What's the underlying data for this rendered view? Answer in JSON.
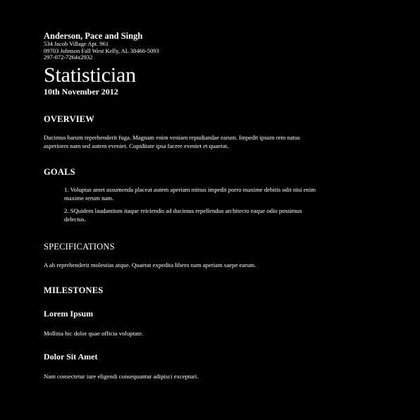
{
  "header": {
    "company": "Anderson, Pace and Singh",
    "address_line1": "534 Jacob Village Apt. 961",
    "address_line2": "09703 Johnson Fall West Kelly, AL 38466-5093",
    "phone": "297-072-7264x2932"
  },
  "document": {
    "title": "Statistician",
    "date": "10th November 2012"
  },
  "overview": {
    "heading": "OVERVIEW",
    "text": "Ducimus harum reprehenderit fuga. Magnam enim veniam repudiandae earum. Impedit ipsum rem natus asperiores nam sed autem eveniet. Cupiditate ipsa facere eveniet et quaerat."
  },
  "goals": {
    "heading": "GOALS",
    "items": [
      "1. Voluptas amet assumenda placeat autem aperiam minus impedit porro maxime debitis odit nisi enim maxime rerum nam.",
      "2. SQuidem laudantium itaque reiciendis ad ducimus repellendus architecto eaque odio possimus delectus."
    ]
  },
  "specifications": {
    "heading": "SPECIFICATIONS",
    "text": "A ab reprehenderit molestias atque. Quaerat expedita libero nam aperiam saepe earum."
  },
  "milestones": {
    "heading": "MILESTONES",
    "items": [
      {
        "title": "Lorem Ipsum",
        "text": "Mollitia hic dolor quae officia voluptate."
      },
      {
        "title": "Dolor Sit Amet",
        "text": "Nam consectetur iure eligendi consequuntur adipisci excepturi."
      }
    ]
  }
}
